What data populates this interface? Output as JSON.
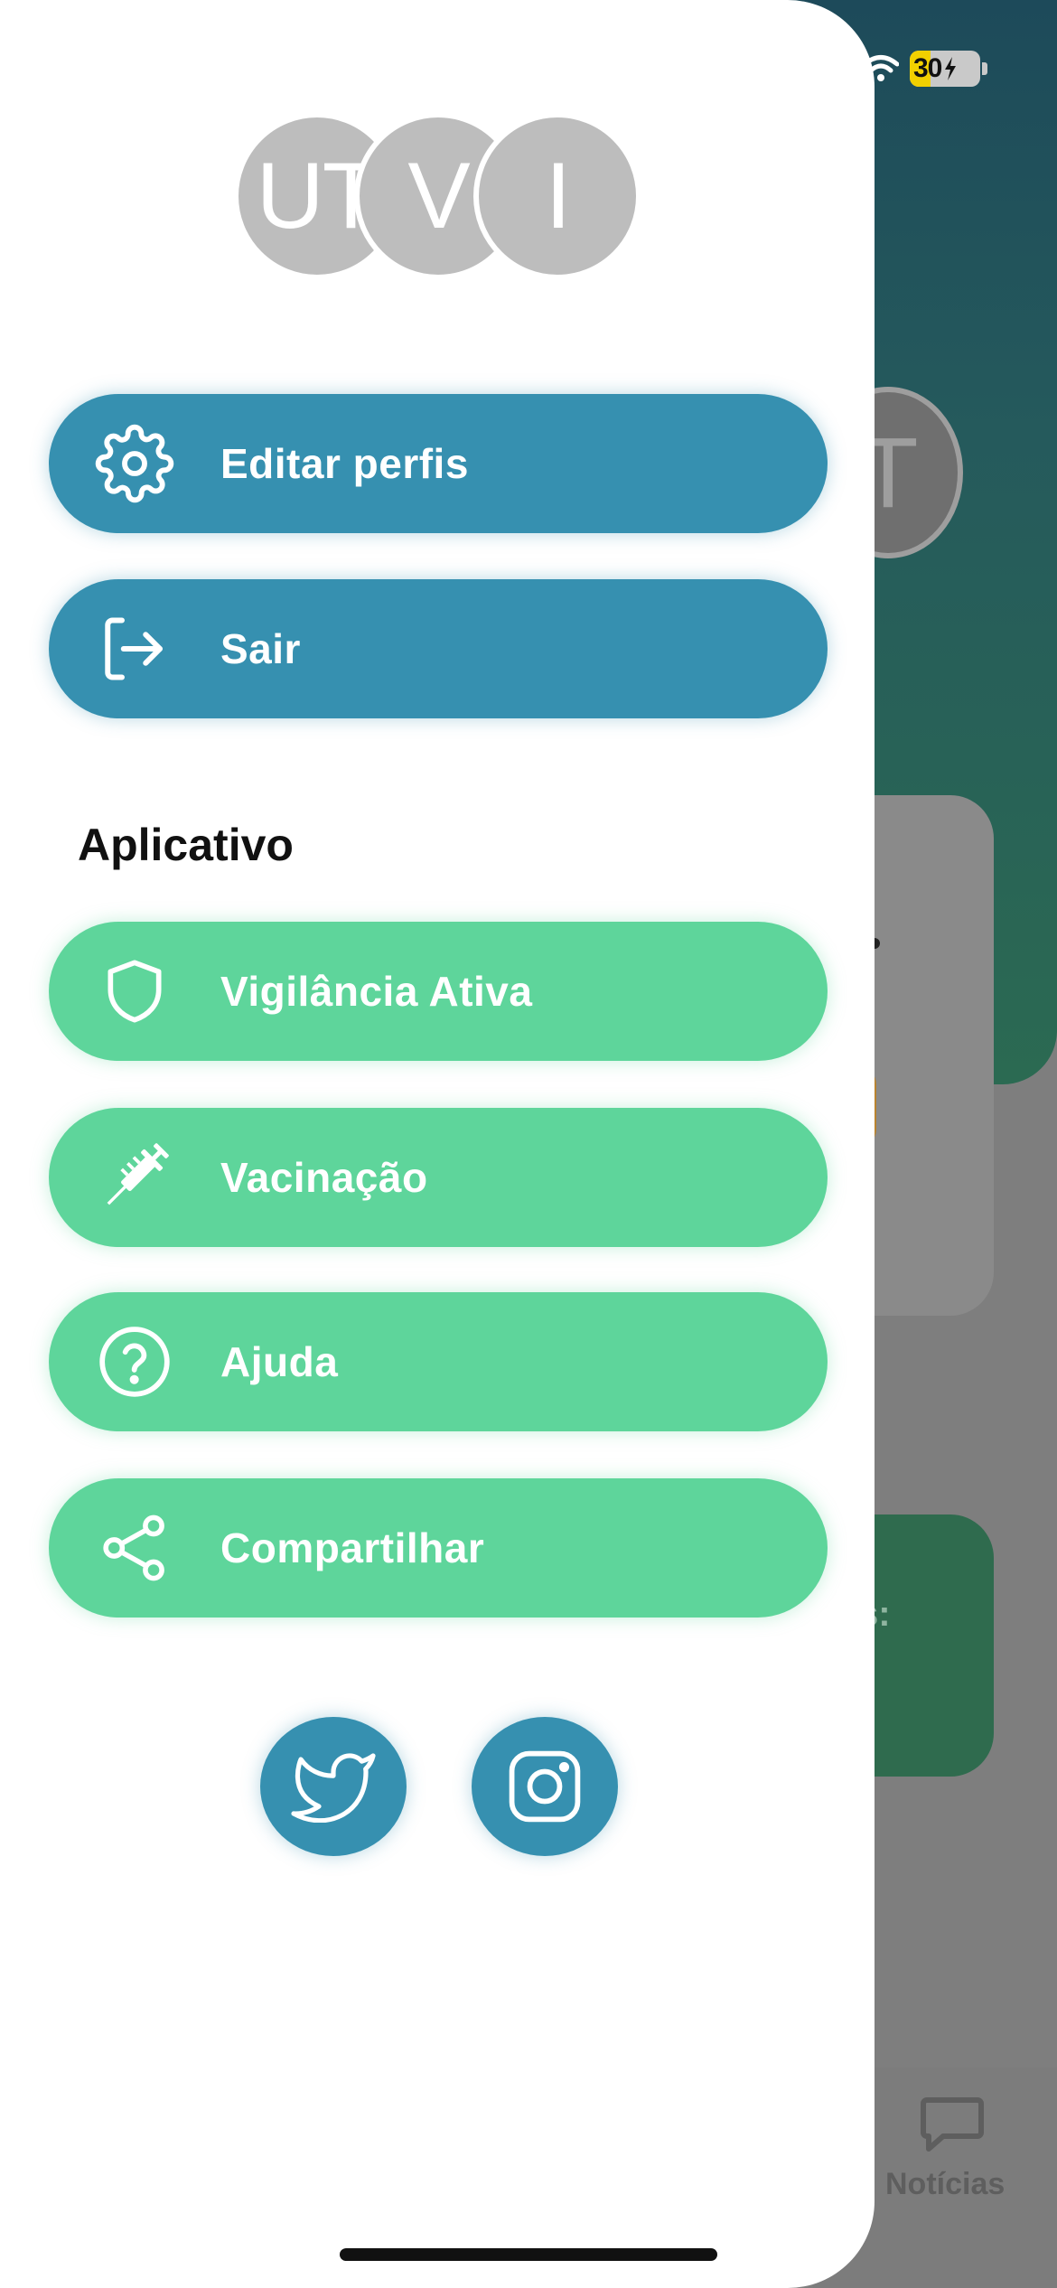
{
  "status_bar": {
    "battery": "30"
  },
  "background": {
    "avatar_letter": "T",
    "card_text": "s:",
    "tab_label": "Notícias"
  },
  "drawer": {
    "logo_letters": [
      "UT",
      "V",
      "I"
    ],
    "buttons": [
      {
        "label": "Editar perfis",
        "icon": "gear-icon"
      },
      {
        "label": "Sair",
        "icon": "logout-icon"
      }
    ],
    "section_title": "Aplicativo",
    "app_items": [
      {
        "label": "Vigilância Ativa",
        "icon": "shield-icon"
      },
      {
        "label": "Vacinação",
        "icon": "syringe-icon"
      },
      {
        "label": "Ajuda",
        "icon": "help-icon"
      },
      {
        "label": "Compartilhar",
        "icon": "share-icon"
      }
    ],
    "social": [
      {
        "name": "twitter",
        "icon": "twitter-icon"
      },
      {
        "name": "instagram",
        "icon": "instagram-icon"
      }
    ]
  },
  "colors": {
    "primary_blue": "#3690b0",
    "accent_green": "#5ed59b",
    "logo_gray": "#bdbdbd"
  }
}
